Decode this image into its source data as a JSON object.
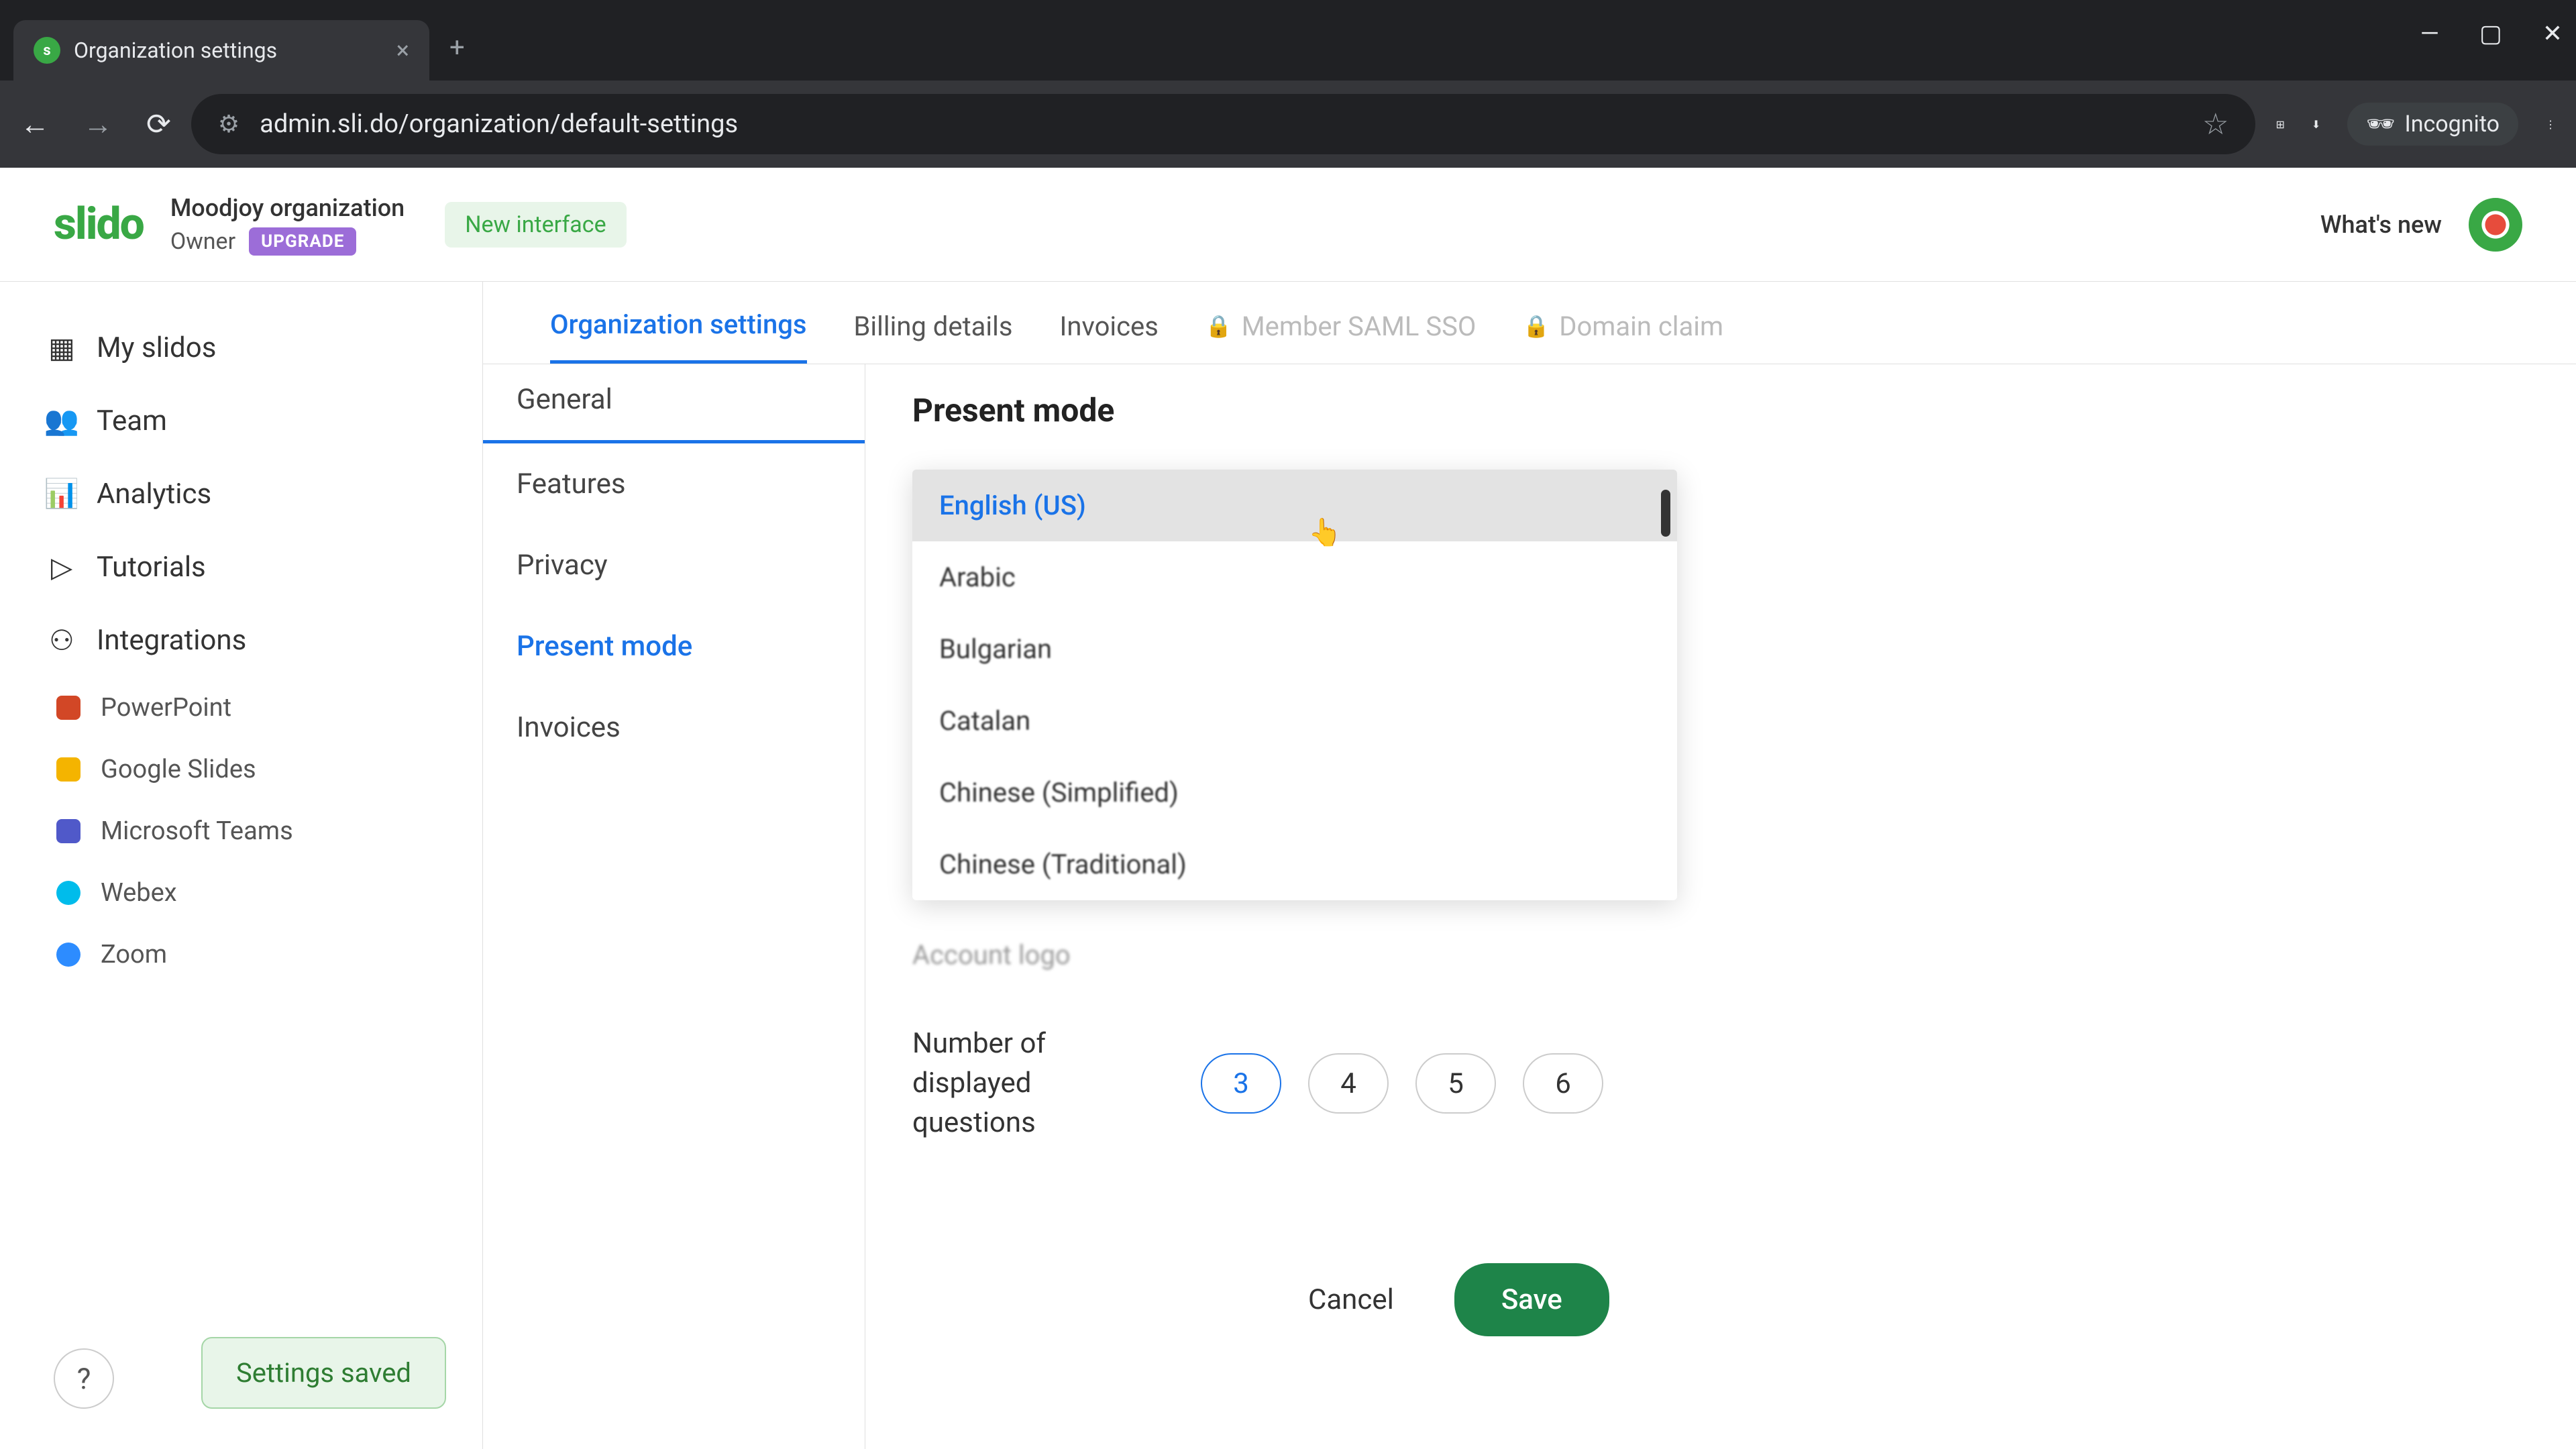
{
  "browser": {
    "tab_title": "Organization settings",
    "url": "admin.sli.do/organization/default-settings",
    "incognito": "Incognito"
  },
  "header": {
    "logo": "slido",
    "org_name": "Moodjoy organization",
    "role": "Owner",
    "upgrade": "UPGRADE",
    "new_interface": "New interface",
    "whats_new": "What's new"
  },
  "sidebar": {
    "my_slidos": "My slidos",
    "team": "Team",
    "analytics": "Analytics",
    "tutorials": "Tutorials",
    "integrations": "Integrations",
    "int_powerpoint": "PowerPoint",
    "int_gslides": "Google Slides",
    "int_msteams": "Microsoft Teams",
    "int_webex": "Webex",
    "int_zoom": "Zoom",
    "help": "?",
    "toast": "Settings saved"
  },
  "tabs": {
    "org_settings": "Organization settings",
    "billing": "Billing details",
    "invoices": "Invoices",
    "saml": "Member SAML SSO",
    "domain": "Domain claim"
  },
  "settings_nav": {
    "general": "General",
    "features": "Features",
    "privacy": "Privacy",
    "present_mode": "Present mode",
    "invoices": "Invoices"
  },
  "panel": {
    "title": "Present mode",
    "dropdown": {
      "selected": "English (US)",
      "options": [
        "Arabic",
        "Bulgarian",
        "Catalan",
        "Chinese (Simplified)",
        "Chinese (Traditional)"
      ]
    },
    "account_logo": "Account logo",
    "nq_label": "Number of displayed questions",
    "nq_options": [
      "3",
      "4",
      "5",
      "6"
    ],
    "cancel": "Cancel",
    "save": "Save"
  }
}
